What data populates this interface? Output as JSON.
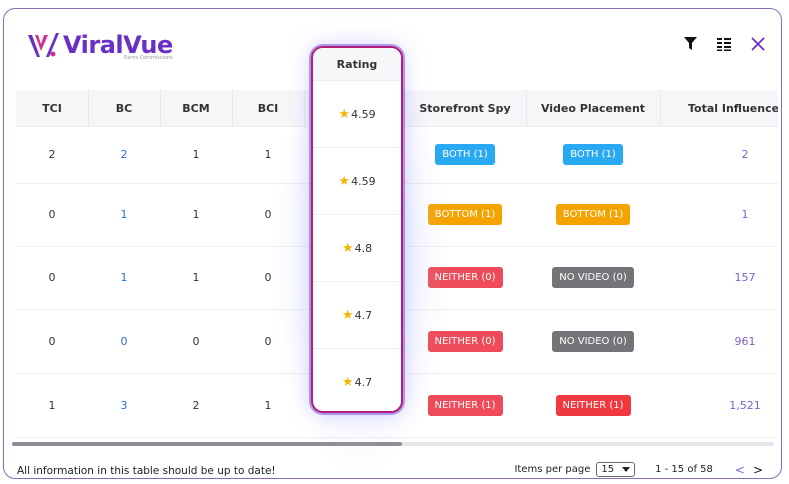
{
  "brand": {
    "name": "ViralVue",
    "tagline": "Earns Commissions"
  },
  "colors": {
    "accent": "#6a2fc4",
    "badge_both": "#29a9f1",
    "badge_bottom": "#f5a300",
    "badge_neither": "#ef4a57",
    "badge_novideo": "#737478"
  },
  "toolbar": {
    "filter_icon": "filter-icon",
    "columns_icon": "columns-icon",
    "close_icon": "close-icon"
  },
  "table": {
    "headers": {
      "tci": "TCI",
      "bc": "BC",
      "bcm": "BCM",
      "bci": "BCI",
      "rating": "Rating",
      "storefront": "Storefront Spy",
      "video": "Video Placement",
      "total": "Total Influencer V"
    },
    "rows": [
      {
        "tci": "2",
        "bc": "2",
        "bcm": "1",
        "bci": "1",
        "rating": "4.59",
        "storefront": "BOTH  (1)",
        "video": "BOTH  (1)",
        "total": "2"
      },
      {
        "tci": "0",
        "bc": "1",
        "bcm": "1",
        "bci": "0",
        "rating": "4.59",
        "storefront": "BOTTOM  (1)",
        "video": "BOTTOM  (1)",
        "total": "1"
      },
      {
        "tci": "0",
        "bc": "1",
        "bcm": "1",
        "bci": "0",
        "rating": "4.8",
        "storefront": "NEITHER  (0)",
        "video": "NO VIDEO  (0)",
        "total": "157"
      },
      {
        "tci": "0",
        "bc": "0",
        "bcm": "0",
        "bci": "0",
        "rating": "4.7",
        "storefront": "NEITHER  (0)",
        "video": "NO VIDEO  (0)",
        "total": "961"
      },
      {
        "tci": "1",
        "bc": "3",
        "bcm": "2",
        "bci": "1",
        "rating": "4.7",
        "storefront": "NEITHER  (1)",
        "video": "NEITHER  (1)",
        "total": "1,521"
      }
    ]
  },
  "footer": {
    "note": "All information in this table should be up to date!",
    "items_per_page_label": "Items per page",
    "items_per_page_value": "15",
    "range": "1 - 15 of 58",
    "prev": "<",
    "next": ">"
  }
}
